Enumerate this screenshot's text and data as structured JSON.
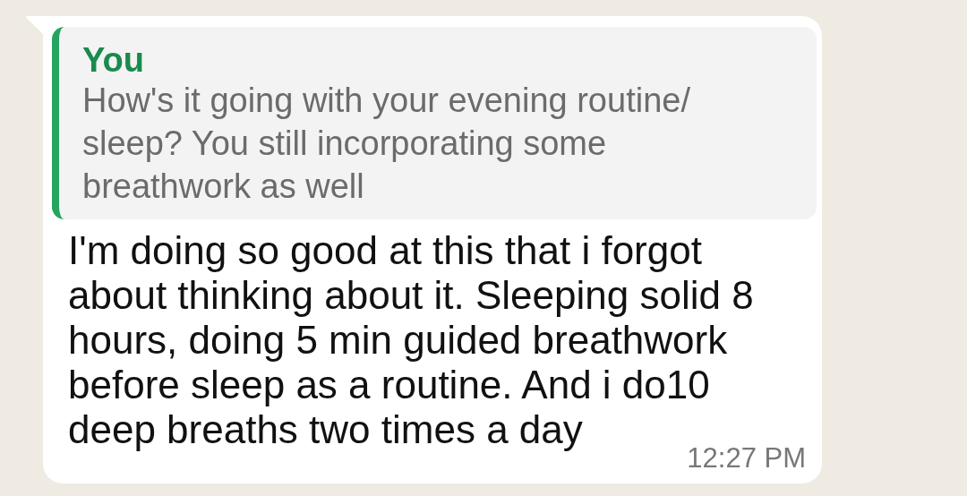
{
  "message": {
    "quote": {
      "author": "You",
      "text": "How's it going with your evening routine/ sleep? You still incorporating some breathwork as well"
    },
    "text": "I'm doing so good at this that i forgot about thinking about it. Sleeping solid 8 hours, doing 5 min guided breathwork before sleep as a routine. And i do10 deep breaths two times a day",
    "time": "12:27 PM"
  }
}
